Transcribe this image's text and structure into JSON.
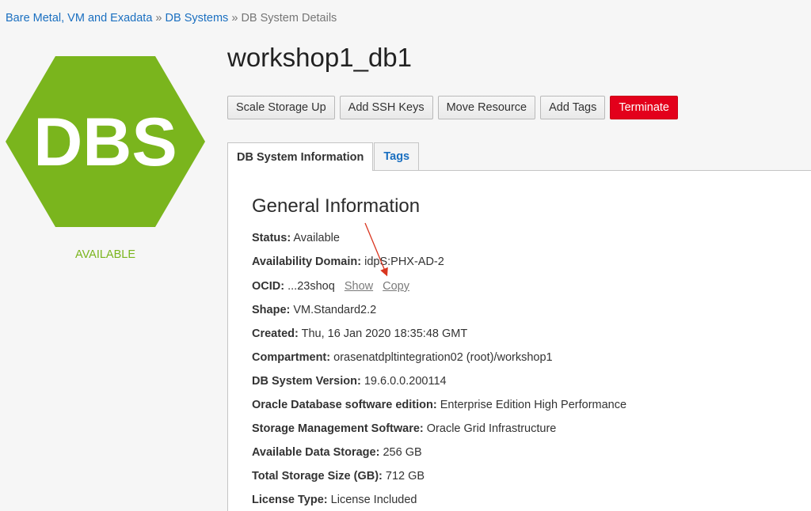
{
  "breadcrumb": {
    "crumbs": [
      "Bare Metal, VM and Exadata",
      "DB Systems",
      "DB System Details"
    ],
    "separator": "»"
  },
  "resource": {
    "icon_text": "DBS",
    "icon_color": "#7ab51d",
    "status": "AVAILABLE",
    "name": "workshop1_db1"
  },
  "actions": [
    "Scale Storage Up",
    "Add SSH Keys",
    "Move Resource",
    "Add Tags",
    "Terminate"
  ],
  "tabs": [
    "DB System Information",
    "Tags"
  ],
  "general": {
    "title": "General Information",
    "status_label": "Status:",
    "status_value": "Available",
    "ad_label": "Availability Domain:",
    "ad_value": "idpS:PHX-AD-2",
    "ocid_label": "OCID:",
    "ocid_value": "...23shoq",
    "ocid_show": "Show",
    "ocid_copy": "Copy",
    "shape_label": "Shape:",
    "shape_value": "VM.Standard2.2",
    "created_label": "Created:",
    "created_value": "Thu, 16 Jan 2020 18:35:48 GMT",
    "compartment_label": "Compartment:",
    "compartment_value": "orasenatdpltintegration02 (root)/workshop1",
    "version_label": "DB System Version:",
    "version_value": "19.6.0.0.200114",
    "edition_label": "Oracle Database software edition:",
    "edition_value": "Enterprise Edition High Performance",
    "storage_mgmt_label": "Storage Management Software:",
    "storage_mgmt_value": "Oracle Grid Infrastructure",
    "avail_storage_label": "Available Data Storage:",
    "avail_storage_value": "256 GB",
    "total_storage_label": "Total Storage Size (GB):",
    "total_storage_value": "712 GB",
    "license_label": "License Type:",
    "license_value": "License Included"
  },
  "colors": {
    "link": "#1a6fc0",
    "danger": "#e3001b",
    "available": "#7ab51d",
    "annotation_arrow": "#d9351f"
  }
}
